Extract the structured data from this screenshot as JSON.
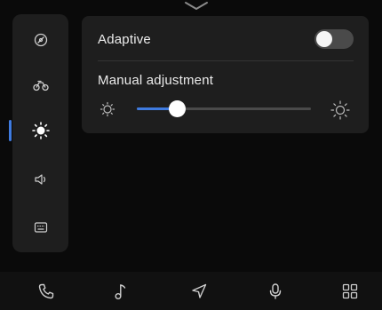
{
  "top_handle": {
    "icon": "chevron-down-icon"
  },
  "sidebar": {
    "items": [
      {
        "id": "general",
        "icon": "target-icon",
        "active": false
      },
      {
        "id": "vehicle",
        "icon": "motorcycle-icon",
        "active": false
      },
      {
        "id": "display",
        "icon": "brightness-icon",
        "active": true
      },
      {
        "id": "sound",
        "icon": "speaker-icon",
        "active": false
      },
      {
        "id": "system",
        "icon": "keyboard-icon",
        "active": false
      }
    ]
  },
  "display_settings": {
    "adaptive_label": "Adaptive",
    "adaptive_enabled": false,
    "manual_label": "Manual adjustment",
    "brightness_level": 0.23,
    "low_icon": "sun-low-icon",
    "high_icon": "sun-high-icon"
  },
  "dock": {
    "items": [
      {
        "id": "phone",
        "icon": "phone-icon"
      },
      {
        "id": "music",
        "icon": "music-note-icon"
      },
      {
        "id": "navigation",
        "icon": "navigation-arrow-icon"
      },
      {
        "id": "voice",
        "icon": "microphone-icon"
      },
      {
        "id": "apps",
        "icon": "grid-icon"
      }
    ]
  },
  "colors": {
    "accent": "#3f7be0",
    "panel": "#1e1e1e",
    "background": "#0a0a0a",
    "icon": "#cfcfcf"
  }
}
